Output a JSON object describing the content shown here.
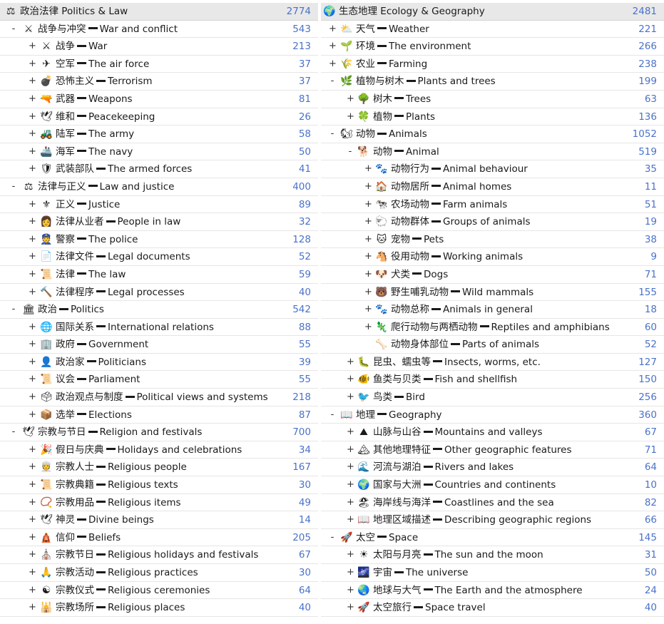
{
  "left": [
    {
      "depth": 0,
      "toggle": "",
      "icon": "⚖",
      "zh": "政治法律",
      "en": "Politics & Law",
      "count": "2774",
      "icon_name": "scales-icon",
      "top": true,
      "sep": " "
    },
    {
      "depth": 1,
      "toggle": "-",
      "icon": "⚔",
      "zh": "战争与冲突",
      "en": "War and conflict",
      "count": "543",
      "icon_name": "crossed-swords-icon"
    },
    {
      "depth": 2,
      "toggle": "+",
      "icon": "⚔",
      "zh": "战争",
      "en": "War",
      "count": "213",
      "icon_name": "crossed-swords-icon"
    },
    {
      "depth": 2,
      "toggle": "+",
      "icon": "✈",
      "zh": "空军",
      "en": "The air force",
      "count": "37",
      "icon_name": "airplane-icon"
    },
    {
      "depth": 2,
      "toggle": "+",
      "icon": "💣",
      "zh": "恐怖主义",
      "en": "Terrorism",
      "count": "37",
      "icon_name": "bomb-icon"
    },
    {
      "depth": 2,
      "toggle": "+",
      "icon": "🔫",
      "zh": "武器",
      "en": "Weapons",
      "count": "81",
      "icon_name": "gun-icon"
    },
    {
      "depth": 2,
      "toggle": "+",
      "icon": "🕊",
      "zh": "维和",
      "en": "Peacekeeping",
      "count": "26",
      "icon_name": "dove-icon"
    },
    {
      "depth": 2,
      "toggle": "+",
      "icon": "🚜",
      "zh": "陆军",
      "en": "The army",
      "count": "58",
      "icon_name": "tank-icon"
    },
    {
      "depth": 2,
      "toggle": "+",
      "icon": "🚢",
      "zh": "海军",
      "en": "The navy",
      "count": "50",
      "icon_name": "ship-icon"
    },
    {
      "depth": 2,
      "toggle": "+",
      "icon": "🛡",
      "zh": "武装部队",
      "en": "The armed forces",
      "count": "41",
      "icon_name": "shield-icon"
    },
    {
      "depth": 1,
      "toggle": "-",
      "icon": "⚖",
      "zh": "法律与正义",
      "en": "Law and justice",
      "count": "400",
      "icon_name": "scales-icon"
    },
    {
      "depth": 2,
      "toggle": "+",
      "icon": "⚜",
      "zh": "正义",
      "en": "Justice",
      "count": "89",
      "icon_name": "justice-icon"
    },
    {
      "depth": 2,
      "toggle": "+",
      "icon": "👩",
      "zh": "法律从业者",
      "en": "People in law",
      "count": "32",
      "icon_name": "judge-icon"
    },
    {
      "depth": 2,
      "toggle": "+",
      "icon": "👮",
      "zh": "警察",
      "en": "The police",
      "count": "128",
      "icon_name": "police-officer-icon"
    },
    {
      "depth": 2,
      "toggle": "+",
      "icon": "📄",
      "zh": "法律文件",
      "en": "Legal documents",
      "count": "52",
      "icon_name": "document-icon"
    },
    {
      "depth": 2,
      "toggle": "+",
      "icon": "📜",
      "zh": "法律",
      "en": "The law",
      "count": "59",
      "icon_name": "scroll-icon"
    },
    {
      "depth": 2,
      "toggle": "+",
      "icon": "🔨",
      "zh": "法律程序",
      "en": "Legal processes",
      "count": "40",
      "icon_name": "gavel-icon"
    },
    {
      "depth": 1,
      "toggle": "-",
      "icon": "🏛",
      "zh": "政治",
      "en": "Politics",
      "count": "542",
      "icon_name": "classical-building-icon"
    },
    {
      "depth": 2,
      "toggle": "+",
      "icon": "🌐",
      "zh": "国际关系",
      "en": "International relations",
      "count": "88",
      "icon_name": "globe-icon"
    },
    {
      "depth": 2,
      "toggle": "+",
      "icon": "🏢",
      "zh": "政府",
      "en": "Government",
      "count": "55",
      "icon_name": "office-building-icon"
    },
    {
      "depth": 2,
      "toggle": "+",
      "icon": "👤",
      "zh": "政治家",
      "en": "Politicians",
      "count": "39",
      "icon_name": "person-icon"
    },
    {
      "depth": 2,
      "toggle": "+",
      "icon": "📜",
      "zh": "议会",
      "en": "Parliament",
      "count": "55",
      "icon_name": "scroll-icon"
    },
    {
      "depth": 2,
      "toggle": "+",
      "icon": "🗳",
      "zh": "政治观点与制度",
      "en": "Political views and systems",
      "count": "218",
      "icon_name": "ballot-box-icon"
    },
    {
      "depth": 2,
      "toggle": "+",
      "icon": "📦",
      "zh": "选举",
      "en": "Elections",
      "count": "87",
      "icon_name": "box-icon"
    },
    {
      "depth": 1,
      "toggle": "-",
      "icon": "🕊",
      "zh": "宗教与节日",
      "en": "Religion and festivals",
      "count": "700",
      "icon_name": "dove-icon"
    },
    {
      "depth": 2,
      "toggle": "+",
      "icon": "🎉",
      "zh": "假日与庆典",
      "en": "Holidays and celebrations",
      "count": "34",
      "icon_name": "party-popper-icon"
    },
    {
      "depth": 2,
      "toggle": "+",
      "icon": "👳",
      "zh": "宗教人士",
      "en": "Religious people",
      "count": "167",
      "icon_name": "religious-person-icon"
    },
    {
      "depth": 2,
      "toggle": "+",
      "icon": "📜",
      "zh": "宗教典籍",
      "en": "Religious texts",
      "count": "30",
      "icon_name": "scroll-icon"
    },
    {
      "depth": 2,
      "toggle": "+",
      "icon": "📿",
      "zh": "宗教用品",
      "en": "Religious items",
      "count": "49",
      "icon_name": "prayer-beads-icon"
    },
    {
      "depth": 2,
      "toggle": "+",
      "icon": "🕊",
      "zh": "神灵",
      "en": "Divine beings",
      "count": "14",
      "icon_name": "dove-icon"
    },
    {
      "depth": 2,
      "toggle": "+",
      "icon": "🛕",
      "zh": "信仰",
      "en": "Beliefs",
      "count": "205",
      "icon_name": "temple-icon"
    },
    {
      "depth": 2,
      "toggle": "+",
      "icon": "⛪",
      "zh": "宗教节日",
      "en": "Religious holidays and festivals",
      "count": "67",
      "icon_name": "church-icon"
    },
    {
      "depth": 2,
      "toggle": "+",
      "icon": "🙏",
      "zh": "宗教活动",
      "en": "Religious practices",
      "count": "30",
      "icon_name": "praying-hands-icon"
    },
    {
      "depth": 2,
      "toggle": "+",
      "icon": "☯",
      "zh": "宗教仪式",
      "en": "Religious ceremonies",
      "count": "64",
      "icon_name": "religious-symbol-icon"
    },
    {
      "depth": 2,
      "toggle": "+",
      "icon": "🕌",
      "zh": "宗教场所",
      "en": "Religious places",
      "count": "40",
      "icon_name": "mosque-icon"
    }
  ],
  "right": [
    {
      "depth": 0,
      "toggle": "",
      "icon": "🌍",
      "zh": "生态地理",
      "en": "Ecology & Geography",
      "count": "2481",
      "icon_name": "globe-icon",
      "top": true,
      "sep": " "
    },
    {
      "depth": 1,
      "toggle": "+",
      "icon": "⛅",
      "zh": "天气",
      "en": "Weather",
      "count": "221",
      "icon_name": "cloud-icon"
    },
    {
      "depth": 1,
      "toggle": "+",
      "icon": "🌱",
      "zh": "环境",
      "en": "The environment",
      "count": "266",
      "icon_name": "seedling-icon"
    },
    {
      "depth": 1,
      "toggle": "+",
      "icon": "🌾",
      "zh": "农业",
      "en": "Farming",
      "count": "238",
      "icon_name": "farming-icon"
    },
    {
      "depth": 1,
      "toggle": "-",
      "icon": "🌿",
      "zh": "植物与树木",
      "en": "Plants and trees",
      "count": "199",
      "icon_name": "leaf-icon"
    },
    {
      "depth": 2,
      "toggle": "+",
      "icon": "🌳",
      "zh": "树木",
      "en": "Trees",
      "count": "63",
      "icon_name": "tree-icon"
    },
    {
      "depth": 2,
      "toggle": "+",
      "icon": "🍀",
      "zh": "植物",
      "en": "Plants",
      "count": "136",
      "icon_name": "clover-icon"
    },
    {
      "depth": 1,
      "toggle": "-",
      "icon": "🐿",
      "zh": "动物",
      "en": "Animals",
      "count": "1052",
      "icon_name": "squirrel-icon"
    },
    {
      "depth": 2,
      "toggle": "-",
      "icon": "🐕",
      "zh": "动物",
      "en": "Animal",
      "count": "519",
      "icon_name": "dog-icon"
    },
    {
      "depth": 3,
      "toggle": "+",
      "icon": "🐾",
      "zh": "动物行为",
      "en": "Animal behaviour",
      "count": "35",
      "icon_name": "paw-icon"
    },
    {
      "depth": 3,
      "toggle": "+",
      "icon": "🏠",
      "zh": "动物居所",
      "en": "Animal homes",
      "count": "11",
      "icon_name": "house-icon"
    },
    {
      "depth": 3,
      "toggle": "+",
      "icon": "🐄",
      "zh": "农场动物",
      "en": "Farm animals",
      "count": "51",
      "icon_name": "cow-icon"
    },
    {
      "depth": 3,
      "toggle": "+",
      "icon": "🐑",
      "zh": "动物群体",
      "en": "Groups of animals",
      "count": "19",
      "icon_name": "sheep-icon"
    },
    {
      "depth": 3,
      "toggle": "+",
      "icon": "🐱",
      "zh": "宠物",
      "en": "Pets",
      "count": "38",
      "icon_name": "cat-icon"
    },
    {
      "depth": 3,
      "toggle": "+",
      "icon": "🐴",
      "zh": "役用动物",
      "en": "Working animals",
      "count": "9",
      "icon_name": "horse-icon"
    },
    {
      "depth": 3,
      "toggle": "+",
      "icon": "🐶",
      "zh": "犬类",
      "en": "Dogs",
      "count": "71",
      "icon_name": "dog-icon"
    },
    {
      "depth": 3,
      "toggle": "+",
      "icon": "🐻",
      "zh": "野生哺乳动物",
      "en": "Wild mammals",
      "count": "155",
      "icon_name": "bear-icon"
    },
    {
      "depth": 3,
      "toggle": "+",
      "icon": "🐾",
      "zh": "动物总称",
      "en": "Animals in general",
      "count": "18",
      "icon_name": "paw-icon"
    },
    {
      "depth": 3,
      "toggle": "+",
      "icon": "🦎",
      "zh": "爬行动物与两栖动物",
      "en": "Reptiles and amphibians",
      "count": "60",
      "icon_name": "lizard-icon"
    },
    {
      "depth": 3,
      "toggle": "",
      "icon": "🦴",
      "zh": "动物身体部位",
      "en": "Parts of animals",
      "count": "52",
      "icon_name": "bone-icon"
    },
    {
      "depth": 2,
      "toggle": "+",
      "icon": "🐛",
      "zh": "昆虫、蠕虫等",
      "en": "Insects, worms, etc.",
      "count": "127",
      "icon_name": "bug-icon"
    },
    {
      "depth": 2,
      "toggle": "+",
      "icon": "🐠",
      "zh": "鱼类与贝类",
      "en": "Fish and shellfish",
      "count": "150",
      "icon_name": "fish-icon"
    },
    {
      "depth": 2,
      "toggle": "+",
      "icon": "🐦",
      "zh": "鸟类",
      "en": "Bird",
      "count": "256",
      "icon_name": "bird-icon"
    },
    {
      "depth": 1,
      "toggle": "-",
      "icon": "📖",
      "zh": "地理",
      "en": "Geography",
      "count": "360",
      "icon_name": "book-icon"
    },
    {
      "depth": 2,
      "toggle": "+",
      "icon": "⛰",
      "zh": "山脉与山谷",
      "en": "Mountains and valleys",
      "count": "67",
      "icon_name": "mountain-icon"
    },
    {
      "depth": 2,
      "toggle": "+",
      "icon": "🏔",
      "zh": "其他地理特征",
      "en": "Other geographic features",
      "count": "71",
      "icon_name": "mountain-peak-icon"
    },
    {
      "depth": 2,
      "toggle": "+",
      "icon": "🌊",
      "zh": "河流与湖泊",
      "en": "Rivers and lakes",
      "count": "64",
      "icon_name": "wave-icon"
    },
    {
      "depth": 2,
      "toggle": "+",
      "icon": "🌍",
      "zh": "国家与大洲",
      "en": "Countries and continents",
      "count": "10",
      "icon_name": "globe-icon"
    },
    {
      "depth": 2,
      "toggle": "+",
      "icon": "🏖",
      "zh": "海岸线与海洋",
      "en": "Coastlines and the sea",
      "count": "82",
      "icon_name": "beach-icon"
    },
    {
      "depth": 2,
      "toggle": "+",
      "icon": "📖",
      "zh": "地理区域描述",
      "en": "Describing geographic regions",
      "count": "66",
      "icon_name": "book-icon"
    },
    {
      "depth": 1,
      "toggle": "-",
      "icon": "🚀",
      "zh": "太空",
      "en": "Space",
      "count": "145",
      "icon_name": "rocket-icon"
    },
    {
      "depth": 2,
      "toggle": "+",
      "icon": "☀",
      "zh": "太阳与月亮",
      "en": "The sun and the moon",
      "count": "31",
      "icon_name": "sun-icon"
    },
    {
      "depth": 2,
      "toggle": "+",
      "icon": "🌌",
      "zh": "宇宙",
      "en": "The universe",
      "count": "50",
      "icon_name": "galaxy-icon"
    },
    {
      "depth": 2,
      "toggle": "+",
      "icon": "🌏",
      "zh": "地球与大气",
      "en": "The Earth and the atmosphere",
      "count": "24",
      "icon_name": "earth-icon"
    },
    {
      "depth": 2,
      "toggle": "+",
      "icon": "🚀",
      "zh": "太空旅行",
      "en": "Space travel",
      "count": "40",
      "icon_name": "rocket-icon"
    }
  ]
}
